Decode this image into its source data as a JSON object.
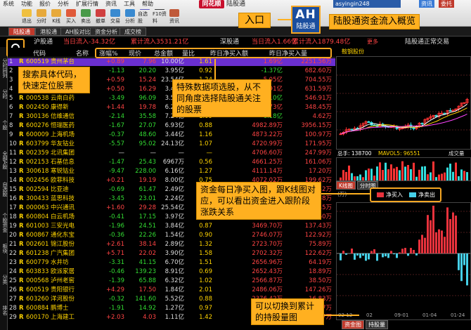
{
  "toolbar": {
    "menu": [
      "系统",
      "功能",
      "报价",
      "分析",
      "扩展行情",
      "资讯",
      "工具",
      "帮助"
    ],
    "logo": "同花顺",
    "window_title": "陆股通",
    "account": "asyingin248",
    "btn_vip": "资讯",
    "btn_msg": "委托",
    "buttons": [
      "退出",
      "分时",
      "K线",
      "买入",
      "卖出",
      "撤单",
      "交易",
      "分析",
      "自选股",
      "F10资料",
      "资讯"
    ]
  },
  "tabs": [
    "陆股通",
    "港股通",
    "AH股对比",
    "资金分析",
    "成交榜"
  ],
  "info": {
    "hgt_label": "沪股通",
    "hgt_day": "当日流入-34.32亿",
    "hgt_total": "累计流入3531.21亿",
    "sgt_label": "深股通",
    "sgt_day": "当日流入1.66亿",
    "sgt_total": "累计流入1879.48亿",
    "more": "更多",
    "status": "陆股通正常交易"
  },
  "vtabs": [
    "分时同列",
    "分时",
    "个股",
    "全部A股",
    "自选股",
    "个股资金",
    "板块",
    "分类",
    "排名"
  ],
  "headers": {
    "code": "代码",
    "name": "名称",
    "chg": "涨幅%",
    "price": "现价",
    "amount": "总金额",
    "ratio": "量比",
    "net_buy": "昨日净买入额",
    "holding": "昨日净买入量"
  },
  "rows": [
    {
      "idx": "1",
      "r": "R",
      "code": "600519",
      "name": "贵州茅台",
      "chg": "+0.89",
      "price": "7.96",
      "amt": "10.00亿",
      "ratio": "1.61",
      "net": "1.69亿",
      "hold": "2251.56万",
      "dir": "up"
    },
    {
      "idx": "2",
      "r": "R",
      "code": "601318",
      "name": "中国平安",
      "chg": "-1.13",
      "price": "20.20",
      "amt": "3.95亿",
      "ratio": "0.92",
      "net": "-1.37亿",
      "hold": "682.60万",
      "dir": "dn"
    },
    {
      "idx": "3",
      "r": "R",
      "code": "000651",
      "name": "格力电器",
      "chg": "+0.59",
      "price": "15.24",
      "amt": "23.54亿",
      "ratio": "1.24",
      "net": "5.05亿",
      "hold": "704.55万",
      "dir": "up"
    },
    {
      "idx": "4",
      "r": "R",
      "code": "000333",
      "name": "美的集团",
      "chg": "+0.50",
      "price": "16.29",
      "amt": "3.41亿",
      "ratio": "1.24",
      "net": "3.91亿",
      "hold": "631.59万",
      "dir": "up"
    },
    {
      "idx": "5",
      "r": "R",
      "code": "000538",
      "name": "云南白药",
      "chg": "-3.49",
      "price": "96.09",
      "amt": "3.55亿",
      "ratio": "0.91",
      "net": "-2.10亿",
      "hold": "546.91万",
      "dir": "dn"
    },
    {
      "idx": "6",
      "r": "R",
      "code": "002450",
      "name": "康得新",
      "chg": "+1.44",
      "price": "19.78",
      "amt": "6.29亿",
      "ratio": "0.84",
      "net": "1.73亿",
      "hold": "348.45万",
      "dir": "up"
    },
    {
      "idx": "7",
      "r": "R",
      "code": "300136",
      "name": "信维通信",
      "chg": "-2.14",
      "price": "35.58",
      "amt": "7.24亿",
      "ratio": "1.09",
      "net": "-6.18亿",
      "hold": "4.62万",
      "dir": "dn"
    },
    {
      "idx": "8",
      "r": "R",
      "code": "600276",
      "name": "恒瑞医药",
      "chg": "-1.67",
      "price": "27.07",
      "amt": "6.93亿",
      "ratio": "0.88",
      "net": "4982.89万",
      "hold": "3956.15万",
      "dir": "dn"
    },
    {
      "idx": "9",
      "r": "R",
      "code": "600009",
      "name": "上海机场",
      "chg": "-0.37",
      "price": "48.60",
      "amt": "3.44亿",
      "ratio": "1.16",
      "net": "4873.22万",
      "hold": "100.97万",
      "dir": "dn"
    },
    {
      "idx": "10",
      "r": "R",
      "code": "603799",
      "name": "华友钴业",
      "chg": "-5.57",
      "price": "95.02",
      "amt": "24.13亿",
      "ratio": "1.07",
      "net": "4720.99万",
      "hold": "171.95万",
      "dir": "dn"
    },
    {
      "idx": "11",
      "r": "R",
      "code": "002359",
      "name": "北讯集团",
      "chg": "—",
      "price": "—",
      "amt": "—",
      "ratio": "—",
      "net": "4706.60万",
      "hold": "247.99万",
      "dir": "wt"
    },
    {
      "idx": "12",
      "r": "R",
      "code": "002153",
      "name": "石基信息",
      "chg": "-1.47",
      "price": "25.43",
      "amt": "6967万",
      "ratio": "0.56",
      "net": "4661.25万",
      "hold": "161.06万",
      "dir": "dn"
    },
    {
      "idx": "13",
      "r": "R",
      "code": "300618",
      "name": "寒锐钴业",
      "chg": "-9.47",
      "price": "228.00",
      "amt": "6.16亿",
      "ratio": "1.27",
      "net": "4111.14万",
      "hold": "17.20万",
      "dir": "dn"
    },
    {
      "idx": "14",
      "r": "R",
      "code": "002456",
      "name": "欧菲科技",
      "chg": "+0.21",
      "price": "19.19",
      "amt": "8.00亿",
      "ratio": "0.75",
      "net": "4072.02万",
      "hold": "199.62万",
      "dir": "up"
    },
    {
      "idx": "15",
      "r": "R",
      "code": "002594",
      "name": "比亚迪",
      "chg": "-0.69",
      "price": "61.47",
      "amt": "2.49亿",
      "ratio": "0.84",
      "net": "3950.88万",
      "hold": "62.42万",
      "dir": "dn"
    },
    {
      "idx": "16",
      "r": "R",
      "code": "300433",
      "name": "蓝思科技",
      "chg": "-3.45",
      "price": "23.01",
      "amt": "2.24亿",
      "ratio": "0.80",
      "net": "3848.95万",
      "hold": "164.38万",
      "dir": "dn"
    },
    {
      "idx": "17",
      "r": "R",
      "code": "000063",
      "name": "中兴通讯",
      "chg": "+1.60",
      "price": "29.28",
      "amt": "25.54亿",
      "ratio": "0.96",
      "net": "3696.72万",
      "hold": "128.45万",
      "dir": "up"
    },
    {
      "idx": "18",
      "r": "R",
      "code": "600804",
      "name": "白云机场",
      "chg": "-0.41",
      "price": "17.15",
      "amt": "3.97亿",
      "ratio": "1.26",
      "net": "3543.54万",
      "hold": "211.60万",
      "dir": "dn"
    },
    {
      "idx": "19",
      "r": "R",
      "code": "601003",
      "name": "三安光电",
      "chg": "-1.96",
      "price": "24.51",
      "amt": "3.84亿",
      "ratio": "0.87",
      "net": "3469.70万",
      "hold": "137.43万",
      "dir": "dn"
    },
    {
      "idx": "20",
      "r": "R",
      "code": "600867",
      "name": "通化东宝",
      "chg": "-0.36",
      "price": "22.26",
      "amt": "1.54亿",
      "ratio": "0.90",
      "net": "2746.07万",
      "hold": "122.92万",
      "dir": "dn"
    },
    {
      "idx": "21",
      "r": "R",
      "code": "002601",
      "name": "锦江股份",
      "chg": "+2.61",
      "price": "38.14",
      "amt": "2.89亿",
      "ratio": "1.32",
      "net": "2723.70万",
      "hold": "75.89万",
      "dir": "up"
    },
    {
      "idx": "22",
      "r": "R",
      "code": "601238",
      "name": "广汽集团",
      "chg": "+5.71",
      "price": "22.02",
      "amt": "3.90亿",
      "ratio": "1.58",
      "net": "2702.32万",
      "hold": "122.62万",
      "dir": "up"
    },
    {
      "idx": "23",
      "r": "R",
      "code": "600779",
      "name": "水井坊",
      "chg": "-3.31",
      "price": "41.15",
      "amt": "6.70亿",
      "ratio": "1.51",
      "net": "2656.96万",
      "hold": "64.19万",
      "dir": "dn"
    },
    {
      "idx": "24",
      "r": "R",
      "code": "603833",
      "name": "欧派家居",
      "chg": "-0.46",
      "price": "139.23",
      "amt": "8.91亿",
      "ratio": "0.69",
      "net": "2652.43万",
      "hold": "18.89万",
      "dir": "dn"
    },
    {
      "idx": "25",
      "r": "R",
      "code": "000568",
      "name": "泸州老窖",
      "chg": "-1.39",
      "price": "65.88",
      "amt": "6.32亿",
      "ratio": "1.02",
      "net": "2566.87万",
      "hold": "38.50万",
      "dir": "dn"
    },
    {
      "idx": "26",
      "r": "R",
      "code": "600519",
      "name": "贵阳银行",
      "chg": "+4.29",
      "price": "17.50",
      "amt": "1.84亿",
      "ratio": "2.01",
      "net": "2486.06万",
      "hold": "147.26万",
      "dir": "up"
    },
    {
      "idx": "27",
      "r": "R",
      "code": "603260",
      "name": "洋河股份",
      "chg": "-0.32",
      "price": "141.60",
      "amt": "5.52亿",
      "ratio": "0.88",
      "net": "2376.42万",
      "hold": "16.83万",
      "dir": "dn"
    },
    {
      "idx": "28",
      "r": "R",
      "code": "600884",
      "name": "鹏博士",
      "chg": "-1.91",
      "price": "14.92",
      "amt": "1.27亿",
      "ratio": "0.97",
      "net": "2324.33万",
      "hold": "159.97万",
      "dir": "dn"
    },
    {
      "idx": "29",
      "r": "R",
      "code": "600170",
      "name": "上海建工",
      "chg": "+2.03",
      "price": "4.03",
      "amt": "1.11亿",
      "ratio": "1.42",
      "net": "2249.15万",
      "hold": "563.17万",
      "dir": "up"
    }
  ],
  "right_panel": {
    "stock_name": "鞍钢股份",
    "vol_label": "总手: 138700",
    "mavol": "MAVOL5: 96551",
    "scale_label": "成交量",
    "k_dates": [
      "2016",
      "01-04",
      "01-24",
      "02"
    ],
    "subtabs": [
      "K线图",
      "分时图"
    ],
    "flow_unit": "(万)",
    "legend_buy": "净买入",
    "legend_sell": "净卖出",
    "flow_dates": [
      "02-12",
      "02",
      "09-01",
      "01-04",
      "01-24"
    ],
    "bottom_tabs": [
      "资金图",
      "持股量"
    ],
    "buy_color": "#e8323c",
    "sell_color": "#45d0e8"
  },
  "callouts": {
    "entry": "入口",
    "ah_big": "AH",
    "ah_small": "陆股通",
    "overview": "陆股通资金流入概览",
    "search": "搜索具体代码，快速定位股票",
    "columns": "特殊数据项选股，从不同角度选择陆股通关注的股票",
    "flow": "资金每日净买入图，跟K线图对应，可以看出资金进入跟阶段涨跌关系",
    "holding": "可以切换到累计的持股量图"
  }
}
